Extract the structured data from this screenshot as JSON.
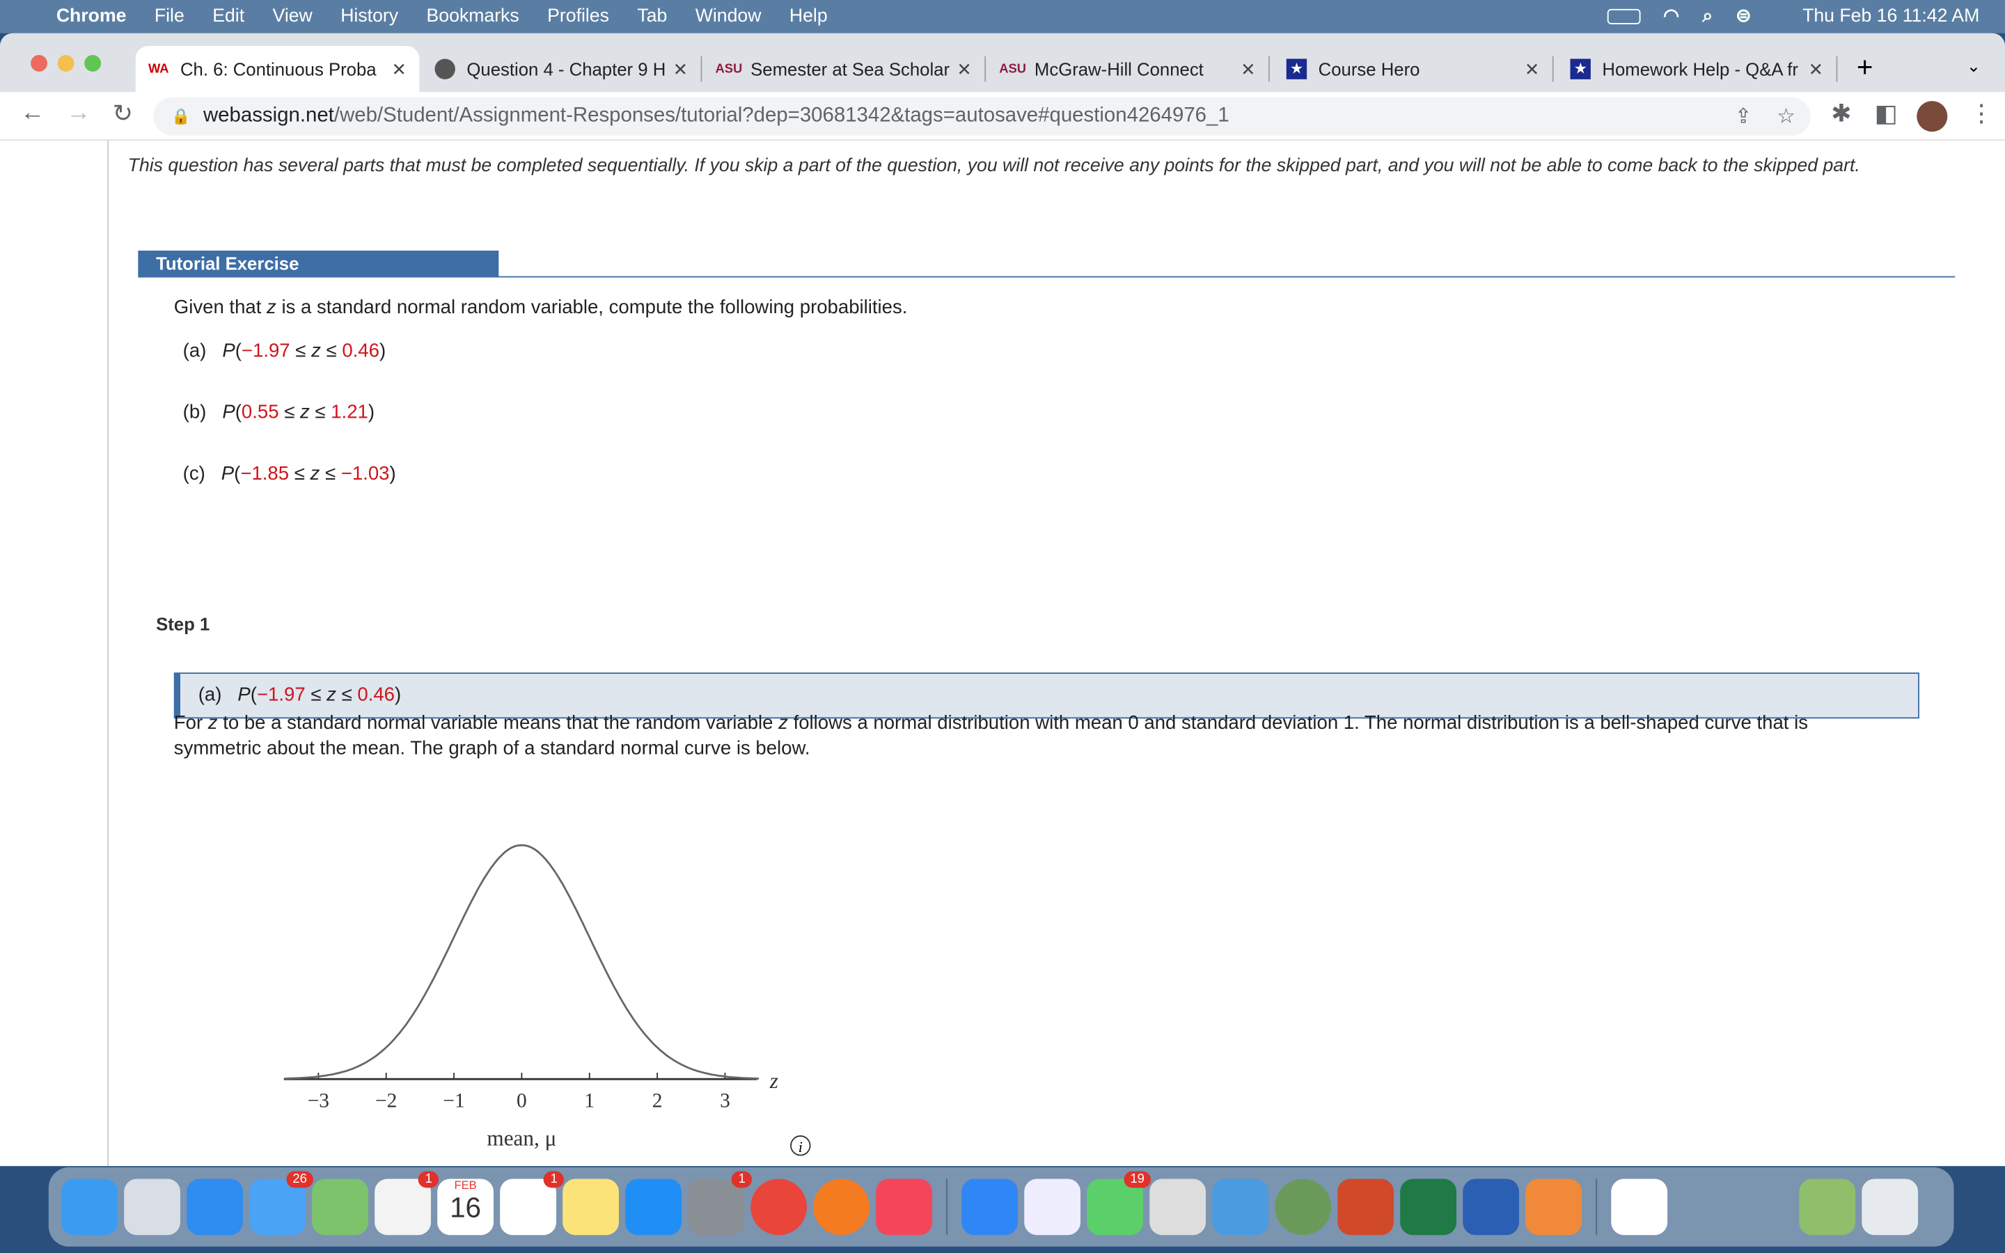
{
  "menubar": {
    "app": "Chrome",
    "items": [
      "File",
      "Edit",
      "View",
      "History",
      "Bookmarks",
      "Profiles",
      "Tab",
      "Window",
      "Help"
    ],
    "clock": "Thu Feb 16  11:42 AM"
  },
  "tabs": [
    {
      "title": "Ch. 6: Continuous Proba",
      "icon": "webassign-icon",
      "active": true
    },
    {
      "title": "Question 4 - Chapter 9 H",
      "icon": "globe-icon"
    },
    {
      "title": "Semester at Sea Scholar",
      "icon": "asu-icon"
    },
    {
      "title": "McGraw-Hill Connect",
      "icon": "asu-icon"
    },
    {
      "title": "Course Hero",
      "icon": "coursehero-icon"
    },
    {
      "title": "Homework Help - Q&A fr",
      "icon": "coursehero-icon"
    }
  ],
  "address": {
    "host": "webassign.net",
    "path": "/web/Student/Assignment-Responses/tutorial?dep=30681342&tags=autosave#question4264976_1"
  },
  "content": {
    "intro": "This question has several parts that must be completed sequentially. If you skip a part of the question, you will not receive any points for the skipped part, and you will not be able to come back to the skipped part.",
    "section_title": "Tutorial Exercise",
    "prompt_pre": "Given that ",
    "prompt_var": "z",
    "prompt_post": " is a standard normal random variable, compute the following probabilities.",
    "parts": [
      {
        "label": "(a)",
        "lo": "−1.97",
        "hi": "0.46"
      },
      {
        "label": "(b)",
        "lo": "0.55",
        "hi": "1.21"
      },
      {
        "label": "(c)",
        "lo": "−1.85",
        "hi": "−1.03"
      }
    ],
    "step_label": "Step 1",
    "step_part": {
      "label": "(a)",
      "lo": "−1.97",
      "hi": "0.46"
    },
    "explanation_1": "For ",
    "explanation_2": " to be a standard normal variable means that the random variable ",
    "explanation_3": " follows a normal distribution with mean 0 and standard deviation 1. The normal distribution is a bell-shaped curve that is symmetric about the mean. The graph of a standard normal curve is below."
  },
  "chart_data": {
    "type": "line",
    "title": "",
    "function": "standard normal density",
    "mean": 0,
    "sd": 1,
    "xlim": [
      -3.5,
      3.5
    ],
    "xticks": [
      "−3",
      "−2",
      "−1",
      "0",
      "1",
      "2",
      "3"
    ],
    "xlabel": "z",
    "caption": "mean, μ",
    "grid": false
  },
  "dock": {
    "badges": {
      "mail": "26",
      "photos": "1",
      "reminders": "1",
      "settings": "1",
      "messages": "19"
    },
    "calendar_month": "FEB",
    "calendar_day": "16"
  },
  "colors": {
    "accent": "#3e6ea6",
    "highlight": "#d0141b"
  }
}
